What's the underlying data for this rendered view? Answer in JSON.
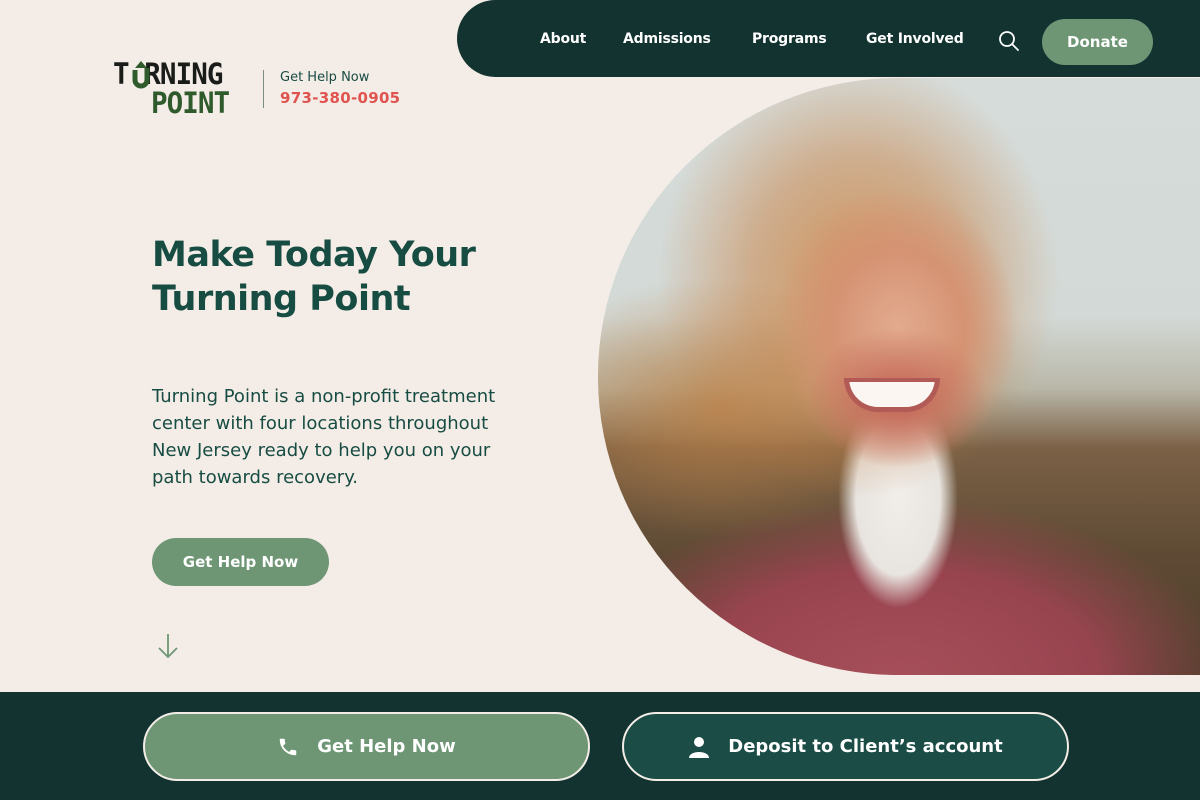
{
  "brand": {
    "logo_line1": "T RNING",
    "logo_line2": "POINT",
    "logo_alt": "Turning Point"
  },
  "header_contact": {
    "label": "Get Help Now",
    "phone": "973-380-0905"
  },
  "nav": {
    "items": [
      {
        "label": "About"
      },
      {
        "label": "Admissions"
      },
      {
        "label": "Programs"
      },
      {
        "label": "Get Involved"
      }
    ],
    "search_icon": "search-icon",
    "donate_label": "Donate"
  },
  "hero": {
    "title": "Make Today Your Turning Point",
    "body": "Turning Point is a non-profit treatment center with four locations throughout New Jersey ready to help you on your path towards recovery.",
    "cta_label": "Get Help Now",
    "scroll_icon": "arrow-down-icon",
    "image_alt": "Smiling woman with wind-blown hair wearing a pink jacket"
  },
  "bottom_bar": {
    "help_label": "Get Help Now",
    "help_icon": "phone-icon",
    "deposit_label": "Deposit to Client’s account",
    "deposit_icon": "user-icon"
  },
  "colors": {
    "dark_green": "#123330",
    "heading_green": "#174c43",
    "sage": "#6e9675",
    "phone_red": "#e0534f",
    "background": "#f4ede7"
  }
}
